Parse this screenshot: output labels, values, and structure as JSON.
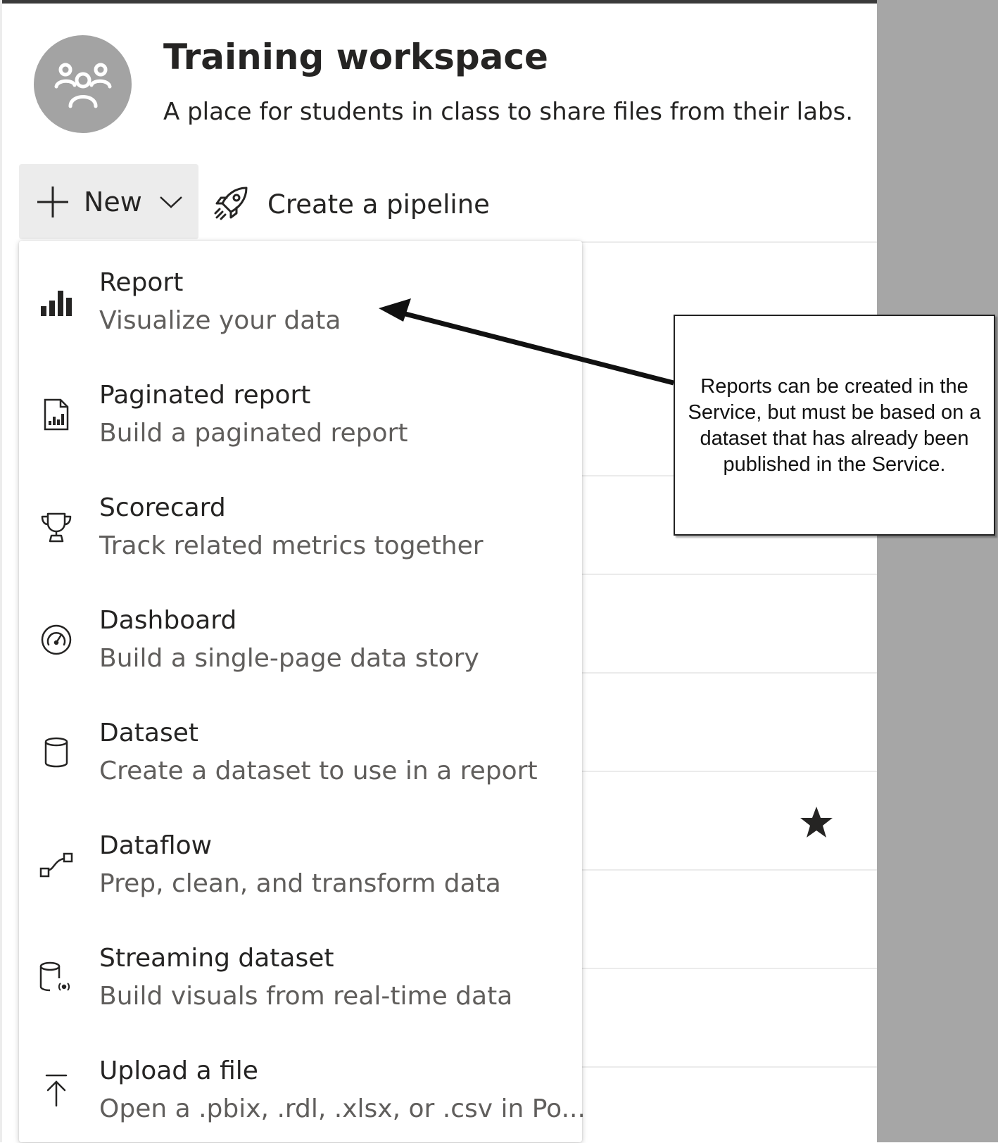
{
  "workspace": {
    "title": "Training workspace",
    "description": "A place for students in class to share files from their labs."
  },
  "toolbar": {
    "new_label": "New",
    "pipeline_label": "Create a pipeline"
  },
  "menu": {
    "items": [
      {
        "title": "Report",
        "subtitle": "Visualize your data",
        "icon": "bar-chart-icon"
      },
      {
        "title": "Paginated report",
        "subtitle": "Build a paginated report",
        "icon": "paginated-report-icon"
      },
      {
        "title": "Scorecard",
        "subtitle": "Track related metrics together",
        "icon": "trophy-icon"
      },
      {
        "title": "Dashboard",
        "subtitle": "Build a single-page data story",
        "icon": "gauge-icon"
      },
      {
        "title": "Dataset",
        "subtitle": "Create a dataset to use in a report",
        "icon": "database-icon"
      },
      {
        "title": "Dataflow",
        "subtitle": "Prep, clean, and transform data",
        "icon": "dataflow-icon"
      },
      {
        "title": "Streaming dataset",
        "subtitle": "Build visuals from real-time data",
        "icon": "streaming-database-icon"
      },
      {
        "title": "Upload a file",
        "subtitle": "Open a .pbix, .rdl, .xlsx, or .csv in Po...",
        "icon": "upload-icon"
      }
    ]
  },
  "callout": {
    "text": "Reports can be created in the Service, but must be based on a dataset that has already been published in the Service."
  },
  "colors": {
    "text": "#252423",
    "subtext": "#605e5c",
    "button_bg": "#ececec",
    "side_panel": "#a6a6a6"
  }
}
